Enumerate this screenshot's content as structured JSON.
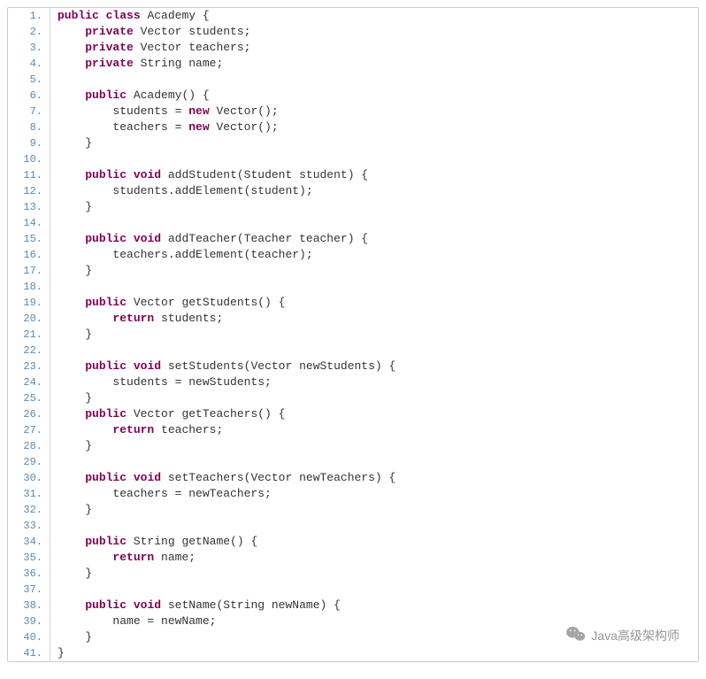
{
  "watermark_text": "Java高级架构师",
  "lines": [
    {
      "n": "1.",
      "tokens": [
        {
          "t": "public",
          "c": "kw"
        },
        {
          "t": " ",
          "c": "plain"
        },
        {
          "t": "class",
          "c": "kw"
        },
        {
          "t": " Academy {",
          "c": "plain"
        }
      ]
    },
    {
      "n": "2.",
      "tokens": [
        {
          "t": "    ",
          "c": "plain"
        },
        {
          "t": "private",
          "c": "kw"
        },
        {
          "t": " Vector students;",
          "c": "plain"
        }
      ]
    },
    {
      "n": "3.",
      "tokens": [
        {
          "t": "    ",
          "c": "plain"
        },
        {
          "t": "private",
          "c": "kw"
        },
        {
          "t": " Vector teachers;",
          "c": "plain"
        }
      ]
    },
    {
      "n": "4.",
      "tokens": [
        {
          "t": "    ",
          "c": "plain"
        },
        {
          "t": "private",
          "c": "kw"
        },
        {
          "t": " String name;",
          "c": "plain"
        }
      ]
    },
    {
      "n": "5.",
      "tokens": [
        {
          "t": "  ",
          "c": "plain"
        }
      ]
    },
    {
      "n": "6.",
      "tokens": [
        {
          "t": "    ",
          "c": "plain"
        },
        {
          "t": "public",
          "c": "kw"
        },
        {
          "t": " Academy() {",
          "c": "plain"
        }
      ]
    },
    {
      "n": "7.",
      "tokens": [
        {
          "t": "        students = ",
          "c": "plain"
        },
        {
          "t": "new",
          "c": "kw"
        },
        {
          "t": " Vector();",
          "c": "plain"
        }
      ]
    },
    {
      "n": "8.",
      "tokens": [
        {
          "t": "        teachers = ",
          "c": "plain"
        },
        {
          "t": "new",
          "c": "kw"
        },
        {
          "t": " Vector();",
          "c": "plain"
        }
      ]
    },
    {
      "n": "9.",
      "tokens": [
        {
          "t": "    }",
          "c": "plain"
        }
      ]
    },
    {
      "n": "10.",
      "tokens": [
        {
          "t": "  ",
          "c": "plain"
        }
      ]
    },
    {
      "n": "11.",
      "tokens": [
        {
          "t": "    ",
          "c": "plain"
        },
        {
          "t": "public",
          "c": "kw"
        },
        {
          "t": " ",
          "c": "plain"
        },
        {
          "t": "void",
          "c": "kw"
        },
        {
          "t": " addStudent(Student student) {",
          "c": "plain"
        }
      ]
    },
    {
      "n": "12.",
      "tokens": [
        {
          "t": "        students.addElement(student);",
          "c": "plain"
        }
      ]
    },
    {
      "n": "13.",
      "tokens": [
        {
          "t": "    }",
          "c": "plain"
        }
      ]
    },
    {
      "n": "14.",
      "tokens": [
        {
          "t": "  ",
          "c": "plain"
        }
      ]
    },
    {
      "n": "15.",
      "tokens": [
        {
          "t": "    ",
          "c": "plain"
        },
        {
          "t": "public",
          "c": "kw"
        },
        {
          "t": " ",
          "c": "plain"
        },
        {
          "t": "void",
          "c": "kw"
        },
        {
          "t": " addTeacher(Teacher teacher) {",
          "c": "plain"
        }
      ]
    },
    {
      "n": "16.",
      "tokens": [
        {
          "t": "        teachers.addElement(teacher);",
          "c": "plain"
        }
      ]
    },
    {
      "n": "17.",
      "tokens": [
        {
          "t": "    }",
          "c": "plain"
        }
      ]
    },
    {
      "n": "18.",
      "tokens": [
        {
          "t": "  ",
          "c": "plain"
        }
      ]
    },
    {
      "n": "19.",
      "tokens": [
        {
          "t": "    ",
          "c": "plain"
        },
        {
          "t": "public",
          "c": "kw"
        },
        {
          "t": " Vector getStudents() {",
          "c": "plain"
        }
      ]
    },
    {
      "n": "20.",
      "tokens": [
        {
          "t": "        ",
          "c": "plain"
        },
        {
          "t": "return",
          "c": "kw"
        },
        {
          "t": " students;",
          "c": "plain"
        }
      ]
    },
    {
      "n": "21.",
      "tokens": [
        {
          "t": "    }",
          "c": "plain"
        }
      ]
    },
    {
      "n": "22.",
      "tokens": [
        {
          "t": "  ",
          "c": "plain"
        }
      ]
    },
    {
      "n": "23.",
      "tokens": [
        {
          "t": "    ",
          "c": "plain"
        },
        {
          "t": "public",
          "c": "kw"
        },
        {
          "t": " ",
          "c": "plain"
        },
        {
          "t": "void",
          "c": "kw"
        },
        {
          "t": " setStudents(Vector newStudents) {",
          "c": "plain"
        }
      ]
    },
    {
      "n": "24.",
      "tokens": [
        {
          "t": "        students = newStudents;",
          "c": "plain"
        }
      ]
    },
    {
      "n": "25.",
      "tokens": [
        {
          "t": "    }",
          "c": "plain"
        }
      ]
    },
    {
      "n": "26.",
      "tokens": [
        {
          "t": "    ",
          "c": "plain"
        },
        {
          "t": "public",
          "c": "kw"
        },
        {
          "t": " Vector getTeachers() {",
          "c": "plain"
        }
      ]
    },
    {
      "n": "27.",
      "tokens": [
        {
          "t": "        ",
          "c": "plain"
        },
        {
          "t": "return",
          "c": "kw"
        },
        {
          "t": " teachers;",
          "c": "plain"
        }
      ]
    },
    {
      "n": "28.",
      "tokens": [
        {
          "t": "    }",
          "c": "plain"
        }
      ]
    },
    {
      "n": "29.",
      "tokens": [
        {
          "t": "  ",
          "c": "plain"
        }
      ]
    },
    {
      "n": "30.",
      "tokens": [
        {
          "t": "    ",
          "c": "plain"
        },
        {
          "t": "public",
          "c": "kw"
        },
        {
          "t": " ",
          "c": "plain"
        },
        {
          "t": "void",
          "c": "kw"
        },
        {
          "t": " setTeachers(Vector newTeachers) {",
          "c": "plain"
        }
      ]
    },
    {
      "n": "31.",
      "tokens": [
        {
          "t": "        teachers = newTeachers;",
          "c": "plain"
        }
      ]
    },
    {
      "n": "32.",
      "tokens": [
        {
          "t": "    }",
          "c": "plain"
        }
      ]
    },
    {
      "n": "33.",
      "tokens": [
        {
          "t": "  ",
          "c": "plain"
        }
      ]
    },
    {
      "n": "34.",
      "tokens": [
        {
          "t": "    ",
          "c": "plain"
        },
        {
          "t": "public",
          "c": "kw"
        },
        {
          "t": " String getName() {",
          "c": "plain"
        }
      ]
    },
    {
      "n": "35.",
      "tokens": [
        {
          "t": "        ",
          "c": "plain"
        },
        {
          "t": "return",
          "c": "kw"
        },
        {
          "t": " name;",
          "c": "plain"
        }
      ]
    },
    {
      "n": "36.",
      "tokens": [
        {
          "t": "    }",
          "c": "plain"
        }
      ]
    },
    {
      "n": "37.",
      "tokens": [
        {
          "t": "  ",
          "c": "plain"
        }
      ]
    },
    {
      "n": "38.",
      "tokens": [
        {
          "t": "    ",
          "c": "plain"
        },
        {
          "t": "public",
          "c": "kw"
        },
        {
          "t": " ",
          "c": "plain"
        },
        {
          "t": "void",
          "c": "kw"
        },
        {
          "t": " setName(String newName) {",
          "c": "plain"
        }
      ]
    },
    {
      "n": "39.",
      "tokens": [
        {
          "t": "        name = newName;",
          "c": "plain"
        }
      ]
    },
    {
      "n": "40.",
      "tokens": [
        {
          "t": "    }",
          "c": "plain"
        }
      ]
    },
    {
      "n": "41.",
      "tokens": [
        {
          "t": "}",
          "c": "plain"
        }
      ]
    }
  ]
}
